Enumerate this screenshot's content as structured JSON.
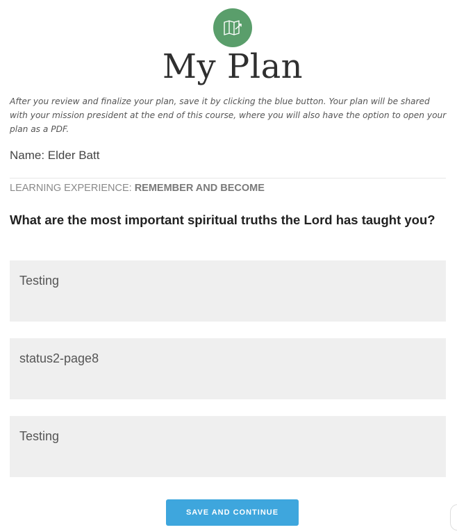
{
  "header": {
    "icon": "map-icon",
    "icon_bg": "#5a9e6b",
    "title": "My Plan"
  },
  "intro": {
    "text": "After you review and finalize your plan, save it by clicking the blue button. Your plan will be shared with your mission president at the end of this course, where you will also have the option to open your plan as a PDF."
  },
  "name": {
    "text": "Name: Elder Batt"
  },
  "experience": {
    "label": "LEARNING EXPERIENCE:",
    "value": "REMEMBER AND BECOME"
  },
  "question": {
    "text": "What are the most important spiritual truths the Lord has taught you?"
  },
  "answers": [
    {
      "value": "Testing"
    },
    {
      "value": "status2-page8"
    },
    {
      "value": "Testing"
    }
  ],
  "actions": {
    "save_label": "SAVE AND CONTINUE",
    "save_color": "#3ea6dd"
  }
}
